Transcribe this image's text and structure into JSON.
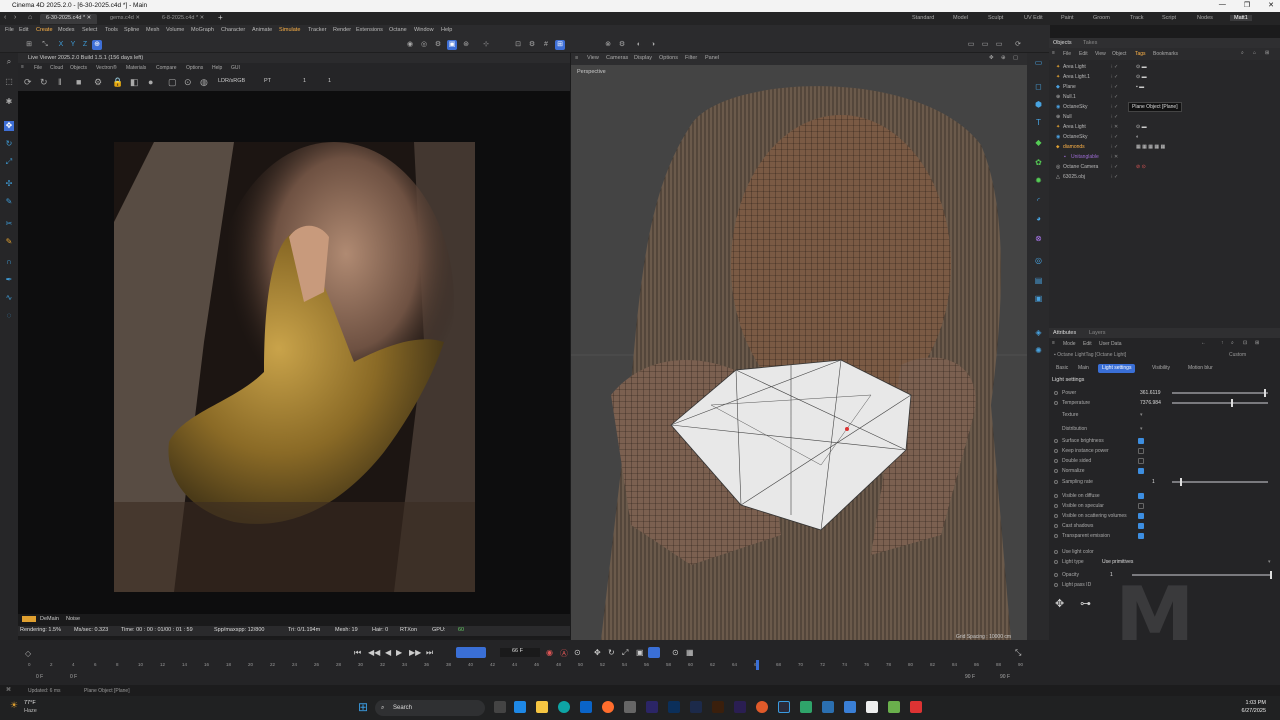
{
  "window": {
    "title": "Cinema 4D 2025.2.0 - [6-30-2025.c4d *] - Main",
    "controls": [
      "—",
      "❐",
      "✕"
    ]
  },
  "tabs": [
    {
      "label": "6-30-2025.c4d *",
      "active": true
    },
    {
      "label": "gems.c4d",
      "active": false
    },
    {
      "label": "6-8-2025.c4d *",
      "active": false
    }
  ],
  "layouts": [
    "Standard",
    "Model",
    "Sculpt",
    "UV Edit",
    "Paint",
    "Groom",
    "Track",
    "Script",
    "Nodes",
    "Matt1"
  ],
  "menu": [
    "File",
    "Edit",
    "Create",
    "Modes",
    "Select",
    "Tools",
    "Spline",
    "Mesh",
    "Volume",
    "MoGraph",
    "Character",
    "Animate",
    "Simulate",
    "Tracker",
    "Render",
    "Extensions",
    "Octane",
    "Window",
    "Help"
  ],
  "live_viewer": {
    "title": "Live Viewer 2025.2.0 Build 1.5.1 (156 days left)",
    "menu": [
      "File",
      "Cloud",
      "Objects",
      "Vectron®",
      "Materials",
      "Compare",
      "Options",
      "Help",
      "GUI"
    ],
    "colorspace": "LDR/sRGB",
    "tonemap": "PT",
    "frame_a": "1",
    "frame_b": "1",
    "channels": [
      "DeMain",
      "Noise"
    ],
    "status": {
      "rendering": "Rendering: 1.5%",
      "ms": "Ms/sec: 0.323",
      "time": "Time: 00 : 00 : 01/00 : 01 : 59",
      "spp": "Spp/maxspp: 12/800",
      "tri": "Tri: 0/1.194m",
      "mesh": "Mesh: 19",
      "hair": "Hair: 0",
      "rtx": "RTXon",
      "gpu": "GPU:",
      "gpu_val": "60"
    }
  },
  "viewport": {
    "menu": [
      "View",
      "Cameras",
      "Display",
      "Options",
      "Filter",
      "Panel"
    ],
    "label": "Perspective",
    "grid": "Grid Spacing : 10000 cm"
  },
  "objects": {
    "tabs": [
      "Objects",
      "Takes"
    ],
    "menu": [
      "File",
      "Edit",
      "View",
      "Object",
      "Tags",
      "Bookmarks"
    ],
    "items": [
      {
        "name": "Area Light",
        "icon": "area-light-icon",
        "color": "#e0a030",
        "indent": 0
      },
      {
        "name": "Area Light.1",
        "icon": "area-light-icon",
        "color": "#e0a030",
        "indent": 0
      },
      {
        "name": "Plane",
        "icon": "plane-icon",
        "color": "#4aa0e0",
        "indent": 0
      },
      {
        "name": "Null.1",
        "icon": "null-icon",
        "color": "#bbbbbb",
        "indent": 0
      },
      {
        "name": "OctaneSky",
        "icon": "sky-icon",
        "color": "#4aa0e0",
        "indent": 0
      },
      {
        "name": "Null",
        "icon": "null-icon",
        "color": "#bbbbbb",
        "indent": 0
      },
      {
        "name": "Area Light",
        "icon": "area-light-icon",
        "color": "#e0a030",
        "indent": 0
      },
      {
        "name": "OctaneSky",
        "icon": "sky-icon",
        "color": "#4aa0e0",
        "indent": 0
      },
      {
        "name": "diamonds",
        "icon": "diamond-icon",
        "color": "#e0a030",
        "indent": 0
      },
      {
        "name": "Unitanglable",
        "icon": "group-icon",
        "color": "#9a6ad0",
        "indent": 1
      },
      {
        "name": "Octane Camera",
        "icon": "camera-icon",
        "color": "#bbbbbb",
        "indent": 0
      },
      {
        "name": "63025.obj",
        "icon": "mesh-icon",
        "color": "#bbbbbb",
        "indent": 0
      }
    ],
    "tooltip": "Plane Object [Plane]"
  },
  "attributes": {
    "tabs": [
      "Attributes",
      "Layers"
    ],
    "menu": [
      "Mode",
      "Edit",
      "User Data"
    ],
    "object": "Octane LightTag [Octane Light]",
    "preset": "Custom",
    "subtabs": [
      {
        "label": "Basic",
        "active": false
      },
      {
        "label": "Main",
        "active": false
      },
      {
        "label": "Light settings",
        "active": true
      },
      {
        "label": "Visibility",
        "active": false
      },
      {
        "label": "Motion blur",
        "active": false
      }
    ],
    "section": "Light settings",
    "power": {
      "label": "Power",
      "value": "361.6119",
      "level": 0.98
    },
    "temperature": {
      "label": "Temperature",
      "value": "7376.984",
      "level": 0.63
    },
    "texture": "Texture",
    "distribution": "Distribution",
    "checks": [
      {
        "label": "Surface brightness",
        "on": true
      },
      {
        "label": "Keep instance power",
        "on": false
      },
      {
        "label": "Double sided",
        "on": false
      },
      {
        "label": "Normalize",
        "on": true
      }
    ],
    "sampling": {
      "label": "Sampling rate",
      "value": "1",
      "level": 0.08
    },
    "checks2": [
      {
        "label": "Visible on diffuse",
        "on": true
      },
      {
        "label": "Visible on specular",
        "on": false
      },
      {
        "label": "Visible on scattering volumes",
        "on": true
      },
      {
        "label": "Cast shadows",
        "on": true
      },
      {
        "label": "Transparent emission",
        "on": true
      }
    ],
    "light_color": "Use light color",
    "light_type": {
      "label": "Light type",
      "value": "Use primitives"
    },
    "opacity": {
      "label": "Opacity",
      "value": "1",
      "level": 1.0
    },
    "light_pass": "Light pass ID"
  },
  "timeline": {
    "frame": "66 F",
    "start": "0 F",
    "start2": "0 F",
    "end": "90 F",
    "end2": "90 F",
    "ticks": [
      "0",
      "2",
      "4",
      "6",
      "8",
      "10",
      "12",
      "14",
      "16",
      "18",
      "20",
      "22",
      "24",
      "26",
      "28",
      "30",
      "32",
      "34",
      "36",
      "38",
      "40",
      "42",
      "44",
      "46",
      "48",
      "50",
      "52",
      "54",
      "56",
      "58",
      "60",
      "62",
      "64",
      "66",
      "68",
      "70",
      "72",
      "74",
      "76",
      "78",
      "80",
      "82",
      "84",
      "86",
      "88",
      "90"
    ]
  },
  "status": {
    "left": "Updated: 6 ms",
    "hint": "Plane Object [Plane]"
  },
  "taskbar": {
    "weather_temp": "77°F",
    "weather_desc": "Haze",
    "search": "Search",
    "time": "1:03 PM",
    "date": "6/27/2025"
  },
  "watermark": "M"
}
